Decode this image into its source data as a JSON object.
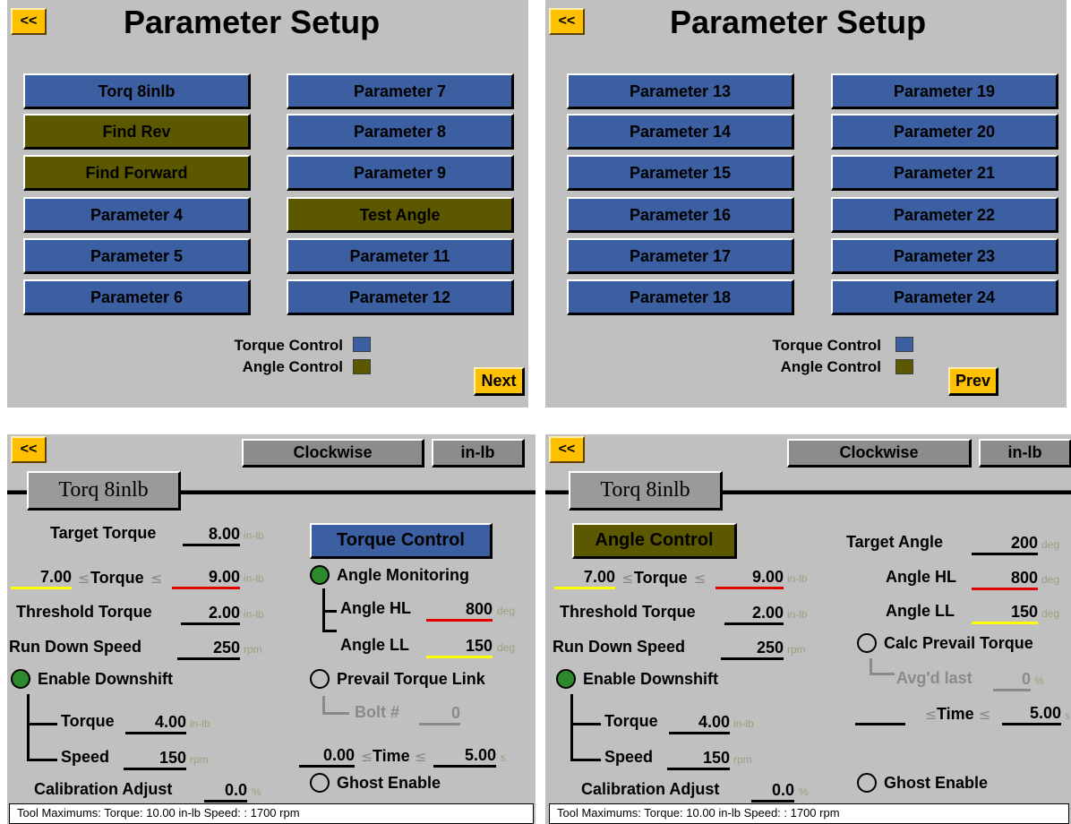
{
  "page1": {
    "back_label": "<<",
    "title": "Parameter Setup",
    "buttons": [
      {
        "label": "Torq 8inlb",
        "color": "blue"
      },
      {
        "label": "Find Rev",
        "color": "olive"
      },
      {
        "label": "Find Forward",
        "color": "olive"
      },
      {
        "label": "Parameter 4",
        "color": "blue"
      },
      {
        "label": "Parameter 5",
        "color": "blue"
      },
      {
        "label": "Parameter 6",
        "color": "blue"
      },
      {
        "label": "Parameter 7",
        "color": "blue"
      },
      {
        "label": "Parameter 8",
        "color": "blue"
      },
      {
        "label": "Parameter 9",
        "color": "blue"
      },
      {
        "label": "Test Angle",
        "color": "olive"
      },
      {
        "label": "Parameter 11",
        "color": "blue"
      },
      {
        "label": "Parameter 12",
        "color": "blue"
      }
    ],
    "legend_torque": "Torque Control",
    "legend_angle": "Angle Control",
    "next_label": "Next"
  },
  "page2": {
    "back_label": "<<",
    "title": "Parameter Setup",
    "buttons": [
      {
        "label": "Parameter 13",
        "color": "blue"
      },
      {
        "label": "Parameter 14",
        "color": "blue"
      },
      {
        "label": "Parameter 15",
        "color": "blue"
      },
      {
        "label": "Parameter 16",
        "color": "blue"
      },
      {
        "label": "Parameter 17",
        "color": "blue"
      },
      {
        "label": "Parameter 18",
        "color": "blue"
      },
      {
        "label": "Parameter 19",
        "color": "blue"
      },
      {
        "label": "Parameter 20",
        "color": "blue"
      },
      {
        "label": "Parameter 21",
        "color": "blue"
      },
      {
        "label": "Parameter 22",
        "color": "blue"
      },
      {
        "label": "Parameter 23",
        "color": "blue"
      },
      {
        "label": "Parameter 24",
        "color": "blue"
      }
    ],
    "legend_torque": "Torque Control",
    "legend_angle": "Angle Control",
    "prev_label": "Prev"
  },
  "colors": {
    "blue": "#3b5fa0",
    "olive": "#5c5800",
    "accent": "#ffc000",
    "red": "#e00000",
    "yellow": "#ffff00",
    "green": "#2c8a2c"
  },
  "page3": {
    "back_label": "<<",
    "direction_label": "Clockwise",
    "units_label": "in-lb",
    "section_title": "Torq 8inlb",
    "target_torque_label": "Target Torque",
    "target_torque_value": "8.00",
    "torque_low": "7.00",
    "torque_mid_label": "Torque",
    "torque_high": "9.00",
    "threshold_label": "Threshold Torque",
    "threshold_value": "2.00",
    "rundown_label": "Run Down Speed",
    "rundown_value": "250",
    "downshift_label": "Enable Downshift",
    "ds_torque_label": "Torque",
    "ds_torque_value": "4.00",
    "ds_speed_label": "Speed",
    "ds_speed_value": "150",
    "calib_label": "Calibration Adjust",
    "calib_value": "0.0",
    "mode_label": "Torque Control",
    "angle_monitor_label": "Angle Monitoring",
    "angle_hl_label": "Angle HL",
    "angle_hl_value": "800",
    "angle_ll_label": "Angle LL",
    "angle_ll_value": "150",
    "prevail_label": "Prevail Torque Link",
    "bolt_label": "Bolt #",
    "bolt_value": "0",
    "time_low": "0.00",
    "time_label": "Time",
    "time_high": "5.00",
    "ghost_label": "Ghost Enable",
    "unit_inlb": "in-lb",
    "unit_rpm": "rpm",
    "unit_deg": "deg",
    "unit_pct": "%",
    "unit_s": "s",
    "le_symbol": "≤",
    "status": "Tool Maximums:  Torque: 10.00  in-lb Speed: : 1700  rpm"
  },
  "page4": {
    "back_label": "<<",
    "direction_label": "Clockwise",
    "units_label": "in-lb",
    "section_title": "Torq 8inlb",
    "mode_label": "Angle Control",
    "torque_low": "7.00",
    "torque_mid_label": "Torque",
    "torque_high": "9.00",
    "threshold_label": "Threshold Torque",
    "threshold_value": "2.00",
    "rundown_label": "Run Down Speed",
    "rundown_value": "250",
    "downshift_label": "Enable Downshift",
    "ds_torque_label": "Torque",
    "ds_torque_value": "4.00",
    "ds_speed_label": "Speed",
    "ds_speed_value": "150",
    "calib_label": "Calibration Adjust",
    "calib_value": "0.0",
    "target_angle_label": "Target Angle",
    "target_angle_value": "200",
    "angle_hl_label": "Angle HL",
    "angle_hl_value": "800",
    "angle_ll_label": "Angle LL",
    "angle_ll_value": "150",
    "calc_prevail_label": "Calc Prevail Torque",
    "avg_label": "Avg'd last",
    "avg_value": "0",
    "time_label": "Time",
    "time_high": "5.00",
    "ghost_label": "Ghost Enable",
    "unit_inlb": "in-lb",
    "unit_rpm": "rpm",
    "unit_deg": "deg",
    "unit_pct": "%",
    "unit_s": "s",
    "le_symbol": "≤",
    "status": "Tool Maximums:  Torque: 10.00  in-lb Speed: : 1700  rpm"
  }
}
